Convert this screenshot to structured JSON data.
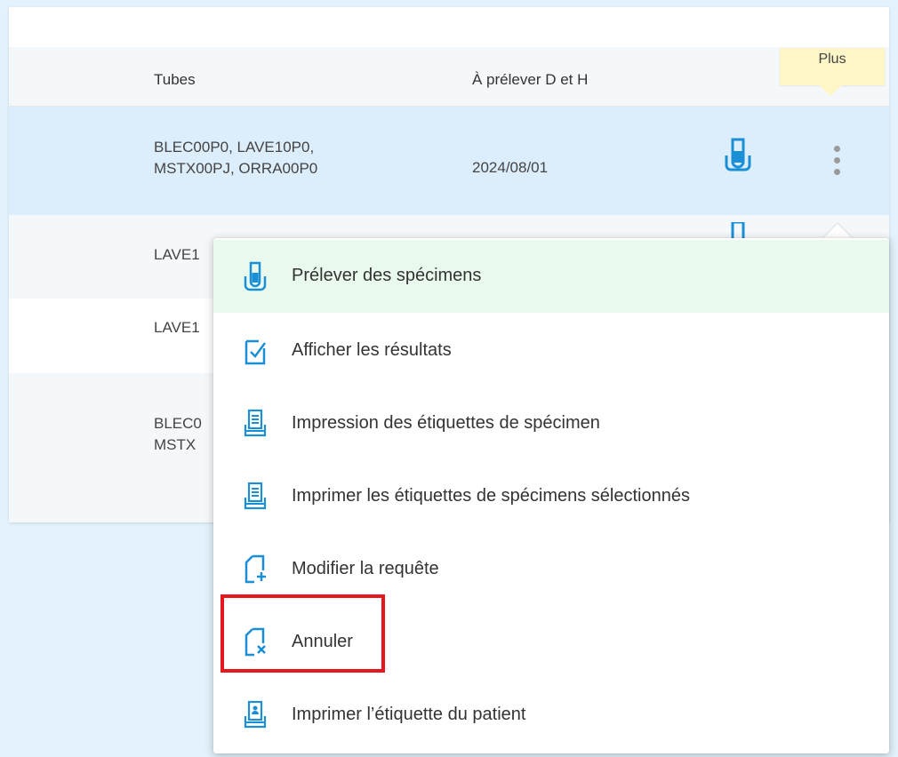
{
  "table": {
    "headers": {
      "tubes": "Tubes",
      "date": "À prélever D et H"
    },
    "rows": [
      {
        "tubes": "BLEC00P0, LAVE10P0,\nMSTX00PJ, ORRA00P0",
        "date": "2024/08/01"
      },
      {
        "tubes": "LAVE1",
        "date": ""
      },
      {
        "tubes": "LAVE1",
        "date": ""
      },
      {
        "tubes": "BLEC0\nMSTX",
        "date": ""
      }
    ]
  },
  "tooltip": {
    "text": "Plus"
  },
  "menu": {
    "items": [
      {
        "label": "Prélever des spécimens",
        "icon": "test-tube-icon"
      },
      {
        "label": "Afficher les résultats",
        "icon": "checklist-icon"
      },
      {
        "label": "Impression des étiquettes de spécimen",
        "icon": "printer-icon"
      },
      {
        "label": "Imprimer les étiquettes de spécimens sélectionnés",
        "icon": "printer-icon"
      },
      {
        "label": "Modifier la requête",
        "icon": "document-plus-icon"
      },
      {
        "label": "Annuler",
        "icon": "document-cancel-icon"
      },
      {
        "label": "Imprimer l’étiquette du patient",
        "icon": "patient-label-printer-icon"
      }
    ]
  },
  "colors": {
    "accent": "#1a8fd6",
    "highlight": "#e5161e",
    "selected_row": "#dcedfb",
    "first_menu_item": "#e9f9ee",
    "tooltip": "#fff6c8"
  }
}
